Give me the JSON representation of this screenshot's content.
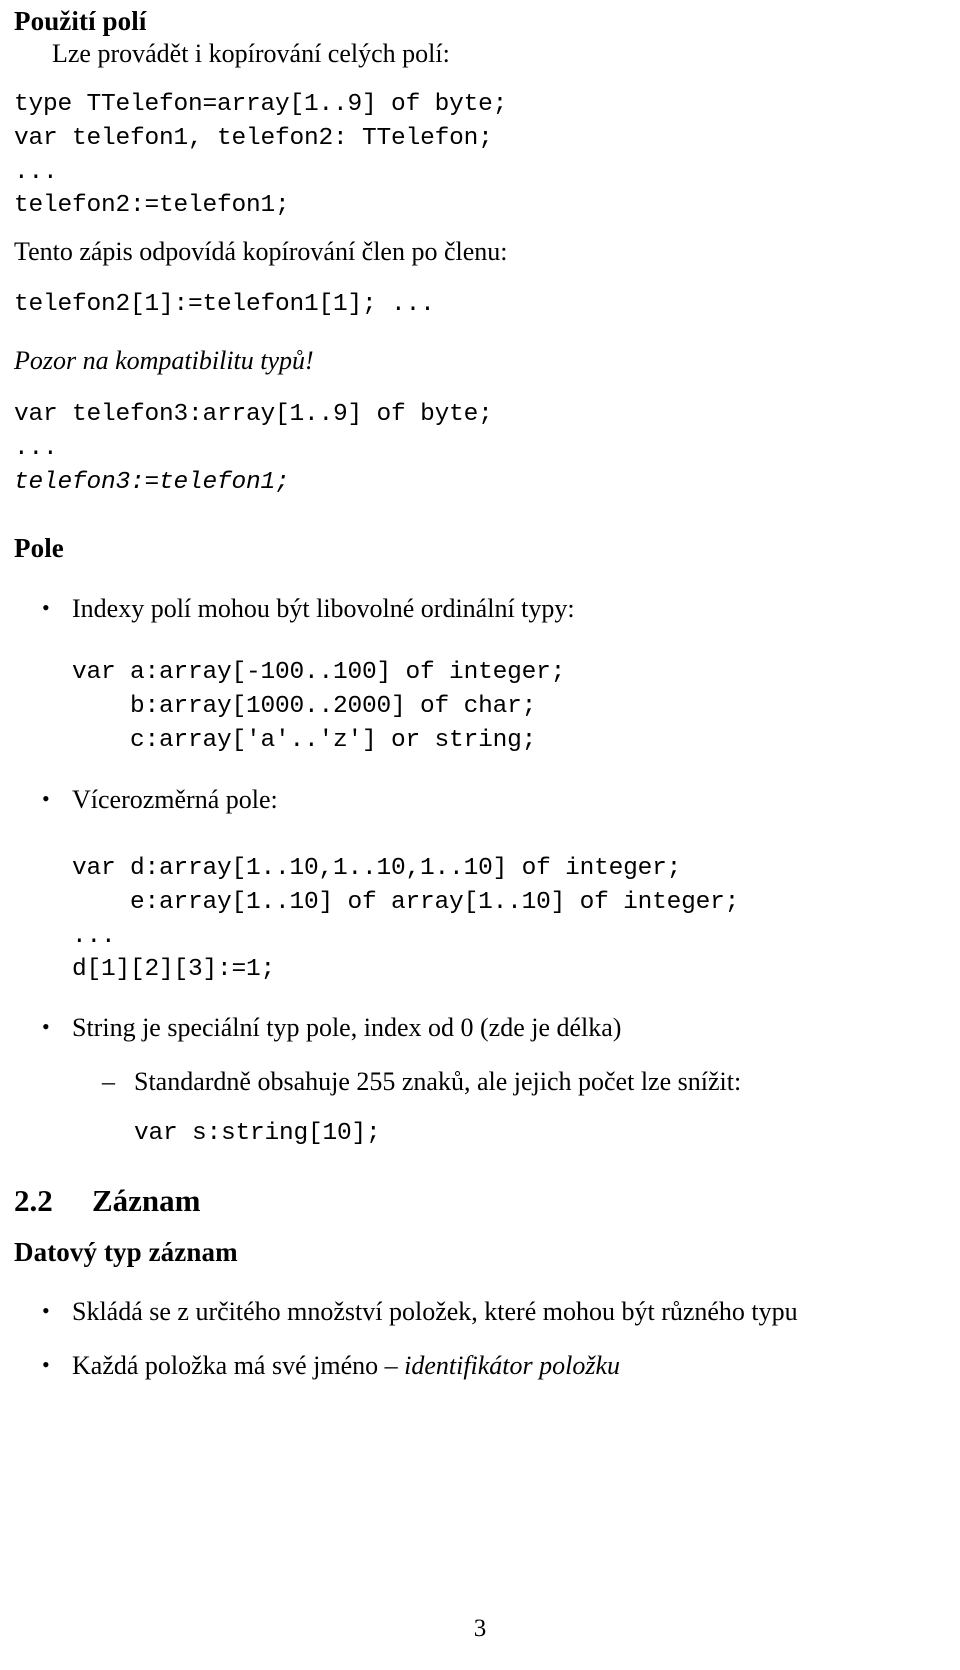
{
  "document": {
    "page_number": "3",
    "bullet_glyph": "•",
    "dash_glyph": "–"
  },
  "section_arrays": {
    "heading": "Použití polí",
    "intro": "Lze provádět i kopírování celých polí:",
    "code_block_1": [
      "type TTelefon=array[1..9] of byte;",
      "var telefon1, telefon2: TTelefon;",
      "...",
      "telefon2:=telefon1;"
    ],
    "para_member_copy": "Tento zápis odpovídá kopírování člen po členu:",
    "code_block_2": [
      "telefon2[1]:=telefon1[1]; ..."
    ],
    "warning_italic": "Pozor na kompatibilitu typů!",
    "code_block_3": [
      "var telefon3:array[1..9] of byte;",
      "..."
    ],
    "code_block_3_slanted": [
      "telefon3:=telefon1;"
    ]
  },
  "pole": {
    "heading": "Pole",
    "items": [
      {
        "text": "Indexy polí mohou být libovolné ordinální typy:",
        "code": [
          "var a:array[-100..100] of integer;",
          "    b:array[1000..2000] of char;",
          "    c:array['a'..'z'] or string;"
        ]
      },
      {
        "text": "Vícerozměrná pole:",
        "code": [
          "var d:array[1..10,1..10,1..10] of integer;",
          "    e:array[1..10] of array[1..10] of integer;",
          "...",
          "d[1][2][3]:=1;"
        ]
      },
      {
        "text": "String je speciální typ pole, index od 0 (zde je délka)",
        "subitem": "Standardně obsahuje 255 znaků, ale jejich počet lze snížit:",
        "subitem_code": [
          "var s:string[10];"
        ]
      }
    ]
  },
  "section_zaznam": {
    "number": "2.2",
    "title": "Záznam",
    "subheading": "Datový typ záznam",
    "items": [
      {
        "text_plain": "Skládá se z určitého množství položek, které mohou být různého typu",
        "text_italic": ""
      },
      {
        "text_plain": "Každá položka má své jméno – ",
        "text_italic": "identifikátor položku"
      }
    ]
  }
}
